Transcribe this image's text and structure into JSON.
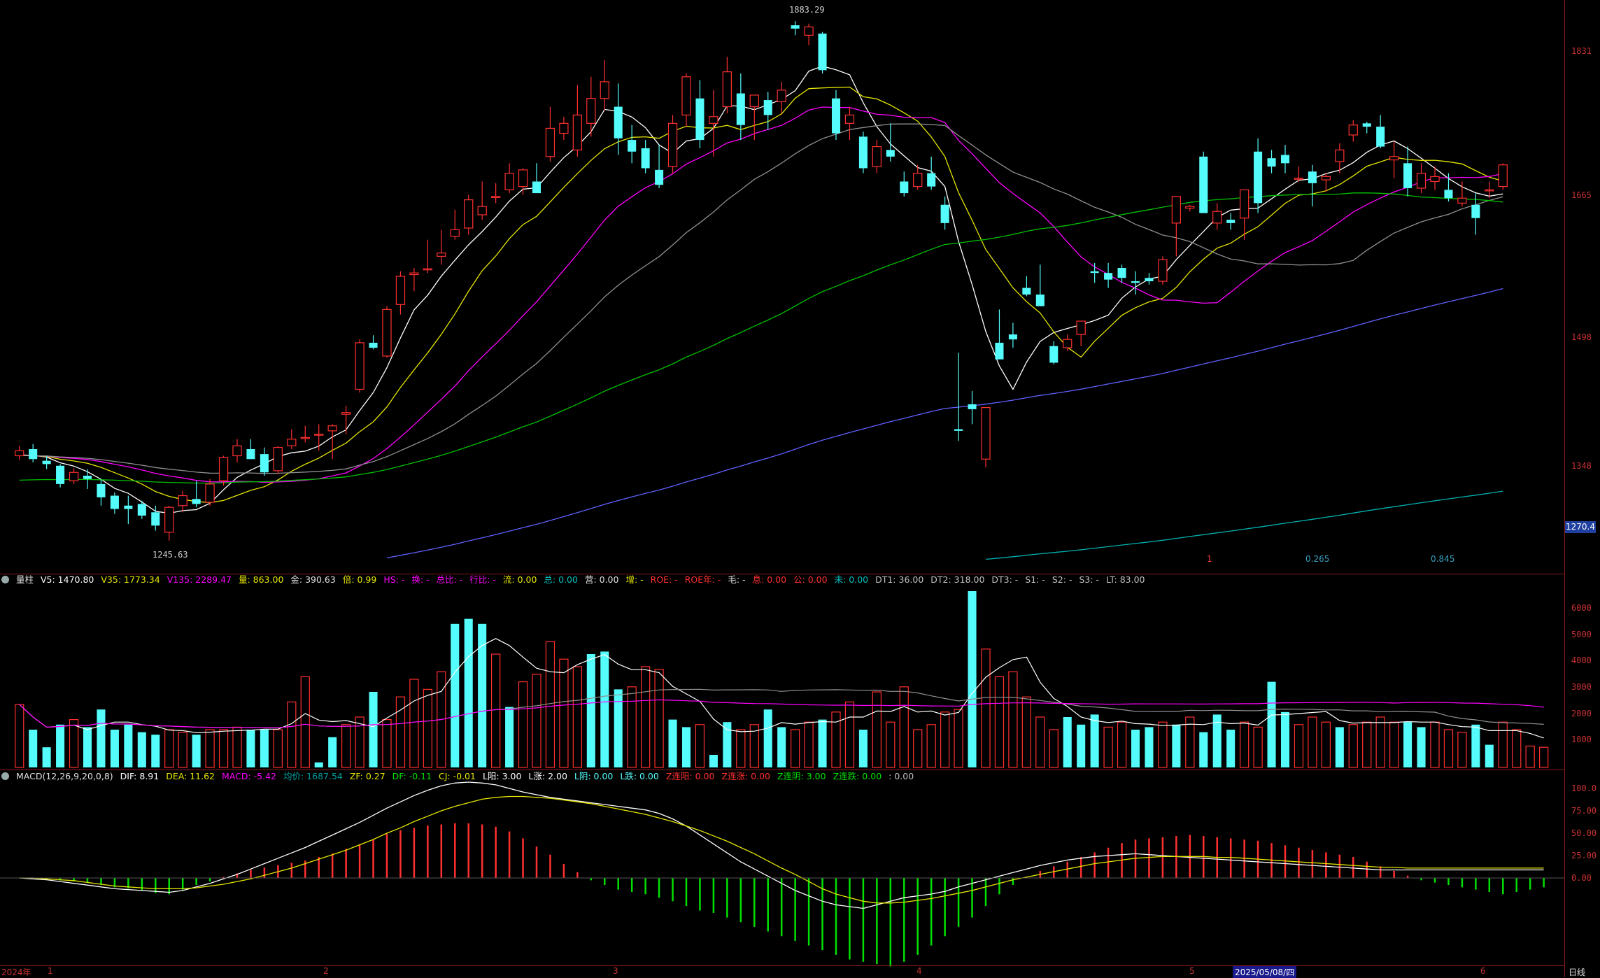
{
  "colors": {
    "up": "#ff3030",
    "down": "#54fcfc",
    "ma5": "#ffffff",
    "ma10": "#e6e600",
    "ma20": "#ff00ff",
    "ma30": "#909090",
    "ma60": "#00c000",
    "ma120": "#6060ff",
    "ma250": "#00b0b0",
    "axis": "#c83232",
    "macd_pos": "#ff3030",
    "macd_neg": "#00e000"
  },
  "price_axis": {
    "ticks": [
      "1831",
      "1665",
      "1498",
      "1348"
    ],
    "current_price": "1270.4",
    "high_label": "1883.29",
    "low_label": "1245.63"
  },
  "ratios": [
    "1",
    "0.265",
    "0.845"
  ],
  "volume_axis": {
    "ticks": [
      "6000",
      "5000",
      "4000",
      "3000",
      "2000",
      "1000"
    ]
  },
  "macd_axis": {
    "ticks": [
      "100.0",
      "75.00",
      "50.00",
      "25.00",
      "0.00"
    ]
  },
  "volume_info": {
    "name": "量柱",
    "v5": "V5: 1470.80",
    "v35": "V35: 1773.34",
    "v135": "V135: 2289.47",
    "liang": "量: 863.00",
    "jin": "金: 390.63",
    "bei": "倍: 0.99",
    "hs": "HS: -",
    "huan": "换: -",
    "zongbi": "总比: -",
    "hangbi": "行比: -",
    "liu": "流: 0.00",
    "zong": "总: 0.00",
    "ying": "营: 0.00",
    "zeng": "增: -",
    "roe": "ROE: -",
    "roe_year": "ROE年: -",
    "mao": "毛: -",
    "xi": "息: 0.00",
    "gong": "公: 0.00",
    "wei": "未: 0.00",
    "dt1": "DT1: 36.00",
    "dt2": "DT2: 318.00",
    "dt3": "DT3: -",
    "s1": "S1: -",
    "s2": "S2: -",
    "s3": "S3: -",
    "lt": "LT: 83.00"
  },
  "macd_info": {
    "name": "MACD(12,26,9,20,0,8)",
    "dif": "DIF: 8.91",
    "dea": "DEA: 11.62",
    "macd": "MACD: -5.42",
    "avg": "均价: 1687.54",
    "zf": "ZF: 0.27",
    "df": "DF: -0.11",
    "cj": "CJ: -0.01",
    "lyang": "L阳: 3.00",
    "lzhang": "L涨: 2.00",
    "lyin": "L阴: 0.00",
    "ldie": "L跌: 0.00",
    "zlianyang": "Z连阳: 0.00",
    "zlianzhang": "Z连涨: 0.00",
    "zlianyin": "Z连阴: 3.00",
    "zliandie": "Z连跌: 0.00",
    "tail": ": 0.00"
  },
  "time_axis": {
    "labels": [
      "2024年",
      "1",
      "2",
      "3",
      "4",
      "5",
      "2025/05/08/四",
      "6"
    ],
    "period": "日线"
  },
  "candles": [
    [
      1360,
      1372,
      1355,
      1366
    ],
    [
      1368,
      1374,
      1352,
      1356
    ],
    [
      1354,
      1360,
      1344,
      1350
    ],
    [
      1348,
      1350,
      1322,
      1326
    ],
    [
      1330,
      1345,
      1326,
      1340
    ],
    [
      1336,
      1344,
      1320,
      1332
    ],
    [
      1326,
      1332,
      1300,
      1310
    ],
    [
      1312,
      1316,
      1290,
      1296
    ],
    [
      1300,
      1312,
      1278,
      1296
    ],
    [
      1302,
      1306,
      1284,
      1288
    ],
    [
      1292,
      1300,
      1270,
      1276
    ],
    [
      1268,
      1300,
      1258,
      1298
    ],
    [
      1300,
      1318,
      1292,
      1312
    ],
    [
      1308,
      1330,
      1298,
      1302
    ],
    [
      1304,
      1332,
      1300,
      1326
    ],
    [
      1330,
      1360,
      1324,
      1358
    ],
    [
      1360,
      1380,
      1352,
      1372
    ],
    [
      1368,
      1380,
      1356,
      1356
    ],
    [
      1362,
      1370,
      1336,
      1340
    ],
    [
      1342,
      1372,
      1338,
      1370
    ],
    [
      1372,
      1392,
      1368,
      1380
    ],
    [
      1382,
      1396,
      1376,
      1382
    ],
    [
      1386,
      1398,
      1366,
      1386
    ],
    [
      1390,
      1398,
      1356,
      1396
    ],
    [
      1410,
      1420,
      1386,
      1412
    ],
    [
      1440,
      1500,
      1436,
      1496
    ],
    [
      1496,
      1505,
      1488,
      1490
    ],
    [
      1480,
      1540,
      1478,
      1536
    ],
    [
      1542,
      1582,
      1530,
      1576
    ],
    [
      1578,
      1586,
      1558,
      1580
    ],
    [
      1585,
      1620,
      1580,
      1585
    ],
    [
      1600,
      1632,
      1590,
      1604
    ],
    [
      1624,
      1656,
      1620,
      1632
    ],
    [
      1634,
      1674,
      1626,
      1668
    ],
    [
      1650,
      1690,
      1644,
      1660
    ],
    [
      1672,
      1688,
      1664,
      1672
    ],
    [
      1680,
      1712,
      1676,
      1700
    ],
    [
      1684,
      1706,
      1674,
      1704
    ],
    [
      1690,
      1712,
      1680,
      1676
    ],
    [
      1720,
      1780,
      1714,
      1754
    ],
    [
      1748,
      1768,
      1740,
      1760
    ],
    [
      1728,
      1806,
      1720,
      1770
    ],
    [
      1760,
      1816,
      1744,
      1790
    ],
    [
      1790,
      1836,
      1776,
      1810
    ],
    [
      1780,
      1808,
      1722,
      1742
    ],
    [
      1740,
      1758,
      1712,
      1726
    ],
    [
      1730,
      1740,
      1700,
      1706
    ],
    [
      1704,
      1734,
      1682,
      1686
    ],
    [
      1708,
      1770,
      1700,
      1760
    ],
    [
      1770,
      1820,
      1756,
      1816
    ],
    [
      1790,
      1812,
      1730,
      1740
    ],
    [
      1760,
      1800,
      1720,
      1768
    ],
    [
      1780,
      1840,
      1772,
      1822
    ],
    [
      1796,
      1820,
      1740,
      1758
    ],
    [
      1780,
      1794,
      1740,
      1794
    ],
    [
      1788,
      1798,
      1752,
      1770
    ],
    [
      1786,
      1810,
      1772,
      1800
    ],
    [
      1878,
      1883,
      1866,
      1874
    ],
    [
      1866,
      1880,
      1854,
      1876
    ],
    [
      1868,
      1870,
      1820,
      1824
    ],
    [
      1790,
      1800,
      1740,
      1748
    ],
    [
      1760,
      1780,
      1740,
      1770
    ],
    [
      1744,
      1750,
      1700,
      1706
    ],
    [
      1708,
      1740,
      1700,
      1732
    ],
    [
      1728,
      1760,
      1714,
      1720
    ],
    [
      1690,
      1702,
      1672,
      1676
    ],
    [
      1684,
      1710,
      1680,
      1700
    ],
    [
      1700,
      1720,
      1680,
      1684
    ],
    [
      1662,
      1672,
      1632,
      1640
    ],
    [
      1392,
      1484,
      1378,
      1390
    ],
    [
      1422,
      1438,
      1398,
      1416
    ],
    [
      1356,
      1410,
      1346,
      1418
    ],
    [
      1496,
      1536,
      1478,
      1476
    ],
    [
      1506,
      1520,
      1490,
      1500
    ],
    [
      1562,
      1576,
      1552,
      1554
    ],
    [
      1554,
      1590,
      1540,
      1540
    ],
    [
      1492,
      1498,
      1470,
      1472
    ],
    [
      1490,
      1506,
      1486,
      1500
    ],
    [
      1506,
      1518,
      1492,
      1522
    ],
    [
      1582,
      1592,
      1568,
      1580
    ],
    [
      1580,
      1592,
      1562,
      1572
    ],
    [
      1586,
      1590,
      1568,
      1574
    ],
    [
      1570,
      1582,
      1554,
      1568
    ],
    [
      1574,
      1580,
      1566,
      1570
    ],
    [
      1570,
      1600,
      1566,
      1596
    ],
    [
      1640,
      1656,
      1600,
      1672
    ],
    [
      1658,
      1662,
      1654,
      1660
    ],
    [
      1720,
      1726,
      1656,
      1652
    ],
    [
      1640,
      1664,
      1632,
      1654
    ],
    [
      1644,
      1652,
      1632,
      1640
    ],
    [
      1646,
      1660,
      1620,
      1680
    ],
    [
      1726,
      1742,
      1652,
      1664
    ],
    [
      1718,
      1728,
      1700,
      1708
    ],
    [
      1722,
      1734,
      1700,
      1712
    ],
    [
      1694,
      1708,
      1690,
      1694
    ],
    [
      1702,
      1710,
      1660,
      1688
    ],
    [
      1692,
      1700,
      1678,
      1696
    ],
    [
      1714,
      1736,
      1700,
      1728
    ],
    [
      1746,
      1764,
      1738,
      1758
    ],
    [
      1760,
      1762,
      1748,
      1756
    ],
    [
      1756,
      1770,
      1730,
      1732
    ],
    [
      1716,
      1738,
      1694,
      1720
    ],
    [
      1712,
      1732,
      1672,
      1682
    ],
    [
      1682,
      1712,
      1676,
      1700
    ],
    [
      1690,
      1708,
      1680,
      1696
    ],
    [
      1680,
      1700,
      1666,
      1670
    ],
    [
      1664,
      1690,
      1660,
      1670
    ],
    [
      1662,
      1676,
      1626,
      1646
    ],
    [
      1680,
      1690,
      1670,
      1680
    ],
    [
      1684,
      1712,
      1680,
      1710
    ]
  ],
  "volumes": [
    2500,
    1500,
    800,
    1700,
    1900,
    1600,
    2300,
    1500,
    1700,
    1400,
    1300,
    1500,
    1400,
    1300,
    1500,
    1500,
    1600,
    1500,
    1500,
    1500,
    2600,
    3600,
    200,
    1200,
    1700,
    2000,
    3000,
    1900,
    2800,
    3500,
    3100,
    3800,
    5700,
    5900,
    5700,
    4500,
    2400,
    3400,
    3700,
    5000,
    4300,
    4000,
    4500,
    4600,
    3100,
    3200,
    4000,
    3900,
    1900,
    1600,
    1700,
    500,
    1800,
    1500,
    1700,
    2300,
    1600,
    1500,
    1800,
    1900,
    2200,
    2600,
    1500,
    3000,
    1800,
    3200,
    1500,
    1700,
    2200,
    2300,
    7000,
    4700,
    3600,
    3800,
    2800,
    2000,
    1500,
    2000,
    1700,
    2100,
    1600,
    1800,
    1500,
    1600,
    1800,
    1700,
    2000,
    1400,
    2100,
    1500,
    1800,
    1600,
    3400,
    2200,
    1700,
    2000,
    1800,
    1600,
    1700,
    1800,
    2000,
    1800,
    1800,
    1600,
    1800,
    1500,
    1400,
    1700,
    900,
    1800,
    1500,
    850,
    800
  ],
  "vol_up": [
    1,
    0,
    0,
    0,
    1,
    0,
    0,
    0,
    0,
    0,
    0,
    1,
    1,
    0,
    1,
    1,
    1,
    0,
    0,
    1,
    1,
    1,
    0,
    0,
    1,
    1,
    0,
    1,
    1,
    1,
    1,
    1,
    0,
    0,
    0,
    1,
    0,
    1,
    1,
    1,
    1,
    1,
    0,
    0,
    0,
    1,
    1,
    1,
    0,
    0,
    1,
    0,
    0,
    1,
    1,
    0,
    0,
    1,
    1,
    0,
    1,
    1,
    0,
    1,
    1,
    1,
    1,
    1,
    1,
    1,
    0,
    1,
    1,
    1,
    1,
    1,
    1,
    0,
    0,
    0,
    1,
    1,
    0,
    0,
    1,
    0,
    1,
    0,
    0,
    0,
    1,
    1,
    0,
    0,
    1,
    1,
    1,
    0,
    1,
    1,
    1,
    1,
    0,
    0,
    1,
    1,
    1,
    0,
    0,
    1,
    1,
    1,
    1
  ],
  "macd_hist": [
    0,
    0,
    -1,
    -2,
    -3,
    -4,
    -6,
    -8,
    -9,
    -11,
    -13,
    -14,
    -10,
    -6,
    -3,
    1,
    4,
    7,
    9,
    11,
    13,
    15,
    18,
    21,
    25,
    29,
    33,
    38,
    41,
    43,
    45,
    46,
    47,
    47,
    46,
    44,
    40,
    34,
    27,
    20,
    12,
    5,
    -2,
    -6,
    -10,
    -12,
    -14,
    -17,
    -20,
    -24,
    -28,
    -30,
    -34,
    -38,
    -42,
    -46,
    -50,
    -54,
    -58,
    -62,
    -66,
    -70,
    -72,
    -74,
    -76,
    -72,
    -66,
    -58,
    -50,
    -42,
    -34,
    -24,
    -14,
    -6,
    1,
    6,
    10,
    14,
    18,
    22,
    26,
    30,
    33,
    34,
    35,
    36,
    37,
    36,
    35,
    34,
    33,
    32,
    30,
    28,
    26,
    24,
    22,
    20,
    18,
    14,
    10,
    6,
    2,
    -2,
    -4,
    -6,
    -8,
    -10,
    -12,
    -14,
    -12,
    -10,
    -8
  ],
  "macd_dif": [
    0,
    -1,
    -2,
    -4,
    -6,
    -8,
    -10,
    -12,
    -13,
    -14,
    -15,
    -16,
    -14,
    -10,
    -6,
    -1,
    4,
    10,
    16,
    22,
    28,
    34,
    41,
    48,
    55,
    62,
    70,
    78,
    85,
    92,
    98,
    103,
    106,
    107,
    106,
    104,
    100,
    96,
    93,
    90,
    88,
    86,
    84,
    82,
    80,
    78,
    76,
    72,
    66,
    58,
    48,
    38,
    28,
    18,
    10,
    2,
    -6,
    -14,
    -20,
    -26,
    -30,
    -32,
    -34,
    -30,
    -26,
    -22,
    -20,
    -18,
    -15,
    -10,
    -6,
    -2,
    2,
    6,
    10,
    14,
    17,
    20,
    22,
    24,
    25,
    26,
    27,
    26,
    25,
    24,
    23,
    22,
    21,
    20,
    19,
    18,
    17,
    16,
    15,
    14,
    13,
    12,
    11,
    10,
    9,
    9,
    9,
    9,
    9,
    9,
    9,
    9,
    9,
    9,
    9,
    9,
    9
  ],
  "macd_dea": [
    0,
    0,
    -1,
    -2,
    -3,
    -5,
    -7,
    -9,
    -10,
    -11,
    -12,
    -12,
    -12,
    -11,
    -9,
    -7,
    -4,
    -1,
    3,
    7,
    11,
    16,
    21,
    26,
    31,
    37,
    43,
    50,
    56,
    63,
    69,
    75,
    80,
    84,
    88,
    90,
    91,
    91,
    90,
    89,
    87,
    85,
    83,
    80,
    77,
    74,
    71,
    67,
    63,
    58,
    53,
    47,
    41,
    34,
    27,
    19,
    11,
    4,
    -4,
    -12,
    -18,
    -22,
    -26,
    -28,
    -28,
    -27,
    -25,
    -23,
    -20,
    -17,
    -14,
    -10,
    -6,
    -2,
    1,
    4,
    7,
    10,
    13,
    16,
    18,
    20,
    22,
    23,
    24,
    24,
    24,
    24,
    23,
    23,
    22,
    21,
    20,
    19,
    18,
    17,
    16,
    15,
    14,
    13,
    12,
    12,
    11,
    11,
    11,
    11,
    11,
    11,
    11,
    11,
    11,
    11,
    11
  ]
}
